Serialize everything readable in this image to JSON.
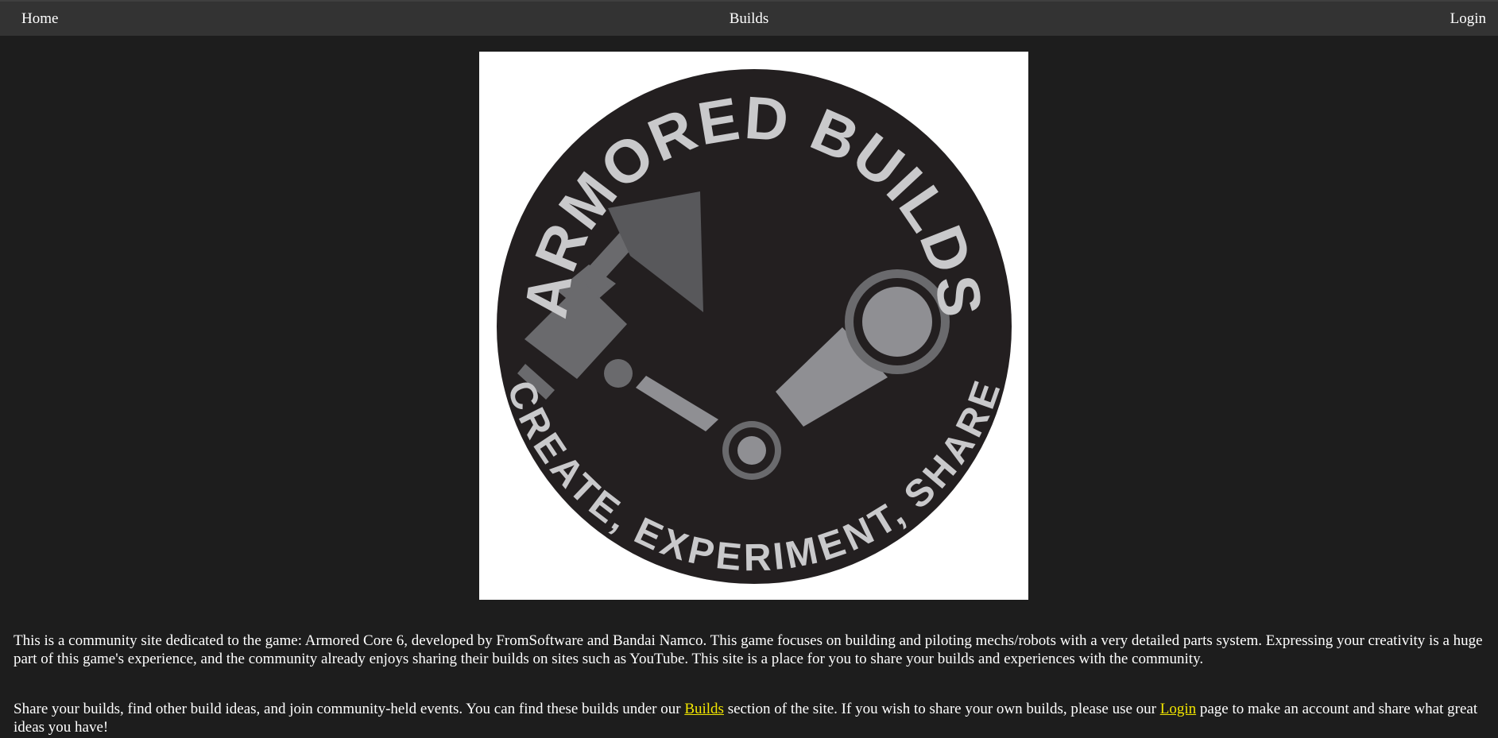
{
  "nav": {
    "home": "Home",
    "builds": "Builds",
    "login": "Login"
  },
  "logo": {
    "top_text": "ARMORED BUILDS",
    "bottom_text": "CREATE, EXPERIMENT, SHARE",
    "colors": {
      "circle": "#231f20",
      "lettering": "#c9c9cb",
      "arm_light": "#8f8f93",
      "arm_dark": "#6a6a6d",
      "arm_darker": "#58585b"
    }
  },
  "intro": {
    "text": "This is a community site dedicated to the game: Armored Core 6, developed by FromSoftware and Bandai Namco. This game focuses on building and piloting mechs/robots with a very detailed parts system. Expressing your creativity is a huge part of this game's experience, and the community already enjoys sharing their builds on sites such as YouTube. This site is a place for you to share your builds and experiences with the community."
  },
  "share": {
    "text_before": "Share your builds, find other build ideas, and join community-held events. You can find these builds under our ",
    "builds_link": "Builds",
    "text_middle": " section of the site. If you wish to share your own builds, please use our ",
    "login_link": "Login",
    "text_after": " page to make an account and share what great ideas you have!"
  },
  "colors": {
    "page_bg": "#1d1d1d",
    "nav_bg": "#333333",
    "link": "#f2e600"
  }
}
